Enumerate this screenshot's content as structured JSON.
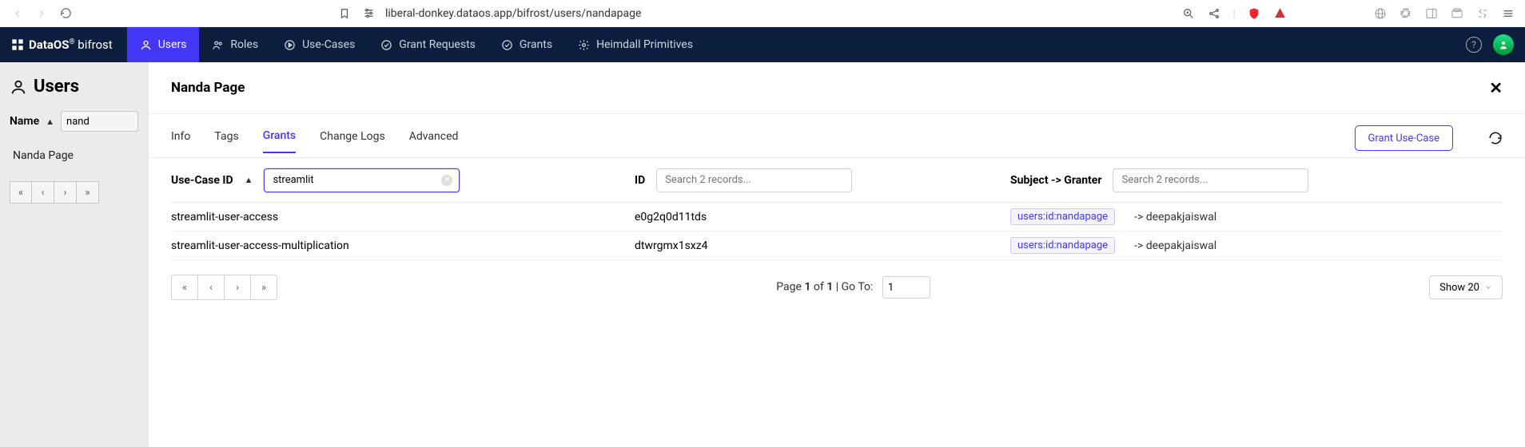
{
  "browser": {
    "url": "liberal-donkey.dataos.app/bifrost/users/nandapage"
  },
  "brand": {
    "name": "DataOS",
    "suffix": "bifrost"
  },
  "nav": {
    "users": "Users",
    "roles": "Roles",
    "usecases": "Use-Cases",
    "grantreq": "Grant Requests",
    "grants": "Grants",
    "heimdall": "Heimdall Primitives"
  },
  "left": {
    "title": "Users",
    "name_label": "Name",
    "name_filter_value": "nand",
    "row0": "Nanda Page"
  },
  "panel": {
    "title": "Nanda Page"
  },
  "tabs": {
    "info": "Info",
    "tags": "Tags",
    "grants": "Grants",
    "changelogs": "Change Logs",
    "advanced": "Advanced",
    "grant_button": "Grant Use-Case"
  },
  "table": {
    "header_usecase": "Use-Case ID",
    "header_id": "ID",
    "header_subject": "Subject -> Granter",
    "filter_usecase_value": "streamlit",
    "filter_placeholder": "Search 2 records...",
    "rows": [
      {
        "uc": "streamlit-user-access",
        "id": "e0g2q0d11tds",
        "subject": "users:id:nandapage",
        "granter": "-> deepakjaiswal"
      },
      {
        "uc": "streamlit-user-access-multiplication",
        "id": "dtwrgmx1sxz4",
        "subject": "users:id:nandapage",
        "granter": "-> deepakjaiswal"
      }
    ]
  },
  "footer": {
    "page_prefix": "Page ",
    "page_mid": " of ",
    "page_suffix": " | Go To: ",
    "page_current": "1",
    "page_total": "1",
    "goto_value": "1",
    "show_label": "Show 20"
  }
}
